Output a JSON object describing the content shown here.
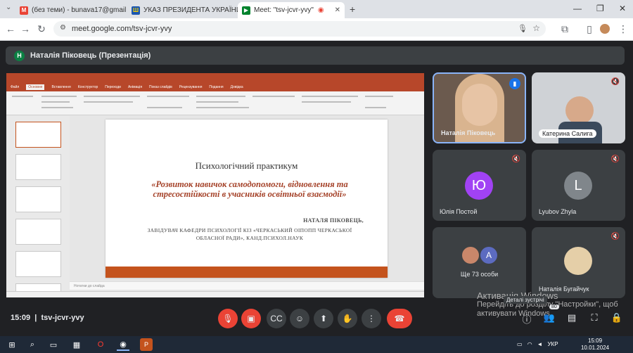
{
  "browser": {
    "tabs": [
      {
        "label": "(без теми) - bunava17@gmail.",
        "favicon": "gmail-icon"
      },
      {
        "label": "УКАЗ ПРЕЗИДЕНТА УКРАЇНИ №",
        "favicon": "trident-icon"
      },
      {
        "label": "Meet: \"tsv-jcvr-yvy\"",
        "favicon": "meet-icon"
      }
    ],
    "url": "meet.google.com/tsv-jcvr-yvy"
  },
  "meet": {
    "presenter_initial": "Н",
    "presenter_banner": "Наталія Піковець (Презентація)",
    "participants": [
      {
        "name": "Наталія Піковець",
        "type": "video",
        "speaking": true
      },
      {
        "name": "Катерина Салига",
        "type": "video",
        "muted": true
      },
      {
        "name": "Юлія Постой",
        "initial": "Ю",
        "color": "#a142f4",
        "muted": true
      },
      {
        "name": "Lyubov Zhyla",
        "initial": "L",
        "color": "#80868b",
        "muted": true
      },
      {
        "name": "Ще 73 особи",
        "initial": "A",
        "color": "#5c6bc0"
      },
      {
        "name": "Наталія Бугайчук",
        "type": "photo",
        "muted": true
      }
    ],
    "time": "15:09",
    "meeting_code": "tsv-jcvr-yvy",
    "details_label": "Деталі зустрічі",
    "people_badge": "80"
  },
  "slide": {
    "title": "Психологічний практикум",
    "subtitle": "«Розвиток навичок самодопомоги, відновлення та стресостійкості в учасників освітньої взаємодії»",
    "author": "НАТАЛЯ ПІКОВЕЦЬ,",
    "role": "ЗАВІДУВАЧ КАФЕДРИ ПСИХОЛОГІЇ КІЗ «ЧЕРКАСЬКИЙ ОІПОПП ЧЕРКАСЬКОЇ ОБЛАСНОЇ РАДИ», КАНД.ПСИХОЛ.НАУК",
    "notes_placeholder": "Нотатки до слайда"
  },
  "ppt": {
    "tabs": [
      "Файл",
      "Основне",
      "Вставлення",
      "Конструктор",
      "Переходи",
      "Анімація",
      "Показ слайдів",
      "Рецензування",
      "Подання",
      "Довідка"
    ]
  },
  "windows": {
    "watermark_title": "Активація Windows",
    "watermark_line1": "Перейдіть до розділу \"Настройки\", щоб",
    "watermark_line2": "активувати Windows.",
    "lang": "УКР",
    "clock_time": "15:09",
    "clock_date": "10.01.2024"
  },
  "colors": {
    "accent_red": "#ea4335",
    "ppt_orange": "#b7472a",
    "slide_bar": "#c4531d"
  }
}
